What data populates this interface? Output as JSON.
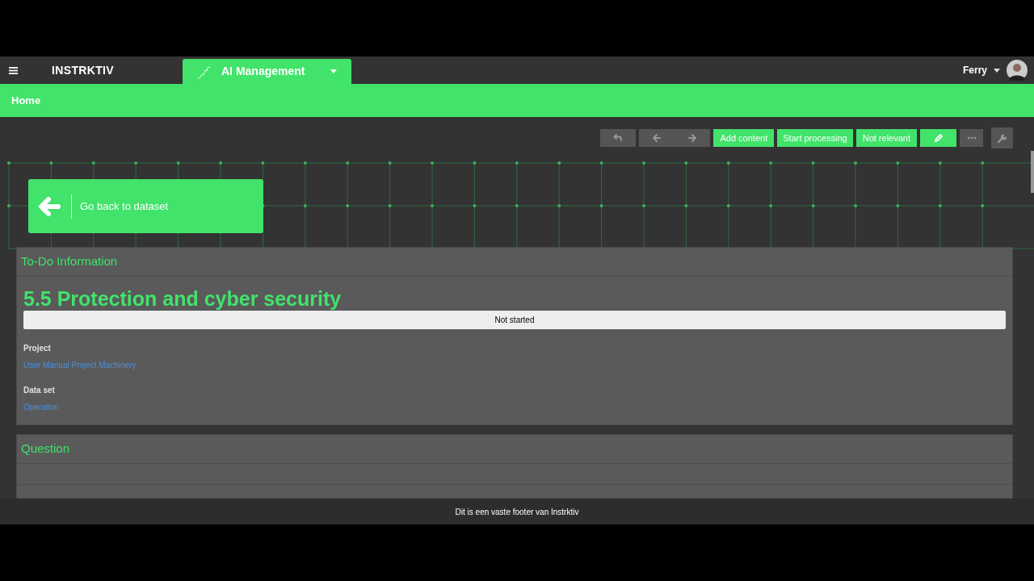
{
  "header": {
    "logo": "INSTRKTIV",
    "module": {
      "label": "AI Management",
      "selected": true
    },
    "user": "Ferry"
  },
  "breadcrumb": "Home",
  "toolbar": [
    {
      "kind": "icon",
      "disabled": true
    },
    {
      "kind": "icon",
      "disabled": true
    },
    {
      "kind": "icon",
      "disabled": true
    },
    {
      "kind": "text",
      "label": "Add content",
      "disabled": false
    },
    {
      "kind": "text",
      "label": "Start processing",
      "disabled": false
    },
    {
      "kind": "text",
      "label": "Not relevant",
      "disabled": false
    },
    {
      "kind": "icon",
      "disabled": false
    },
    {
      "kind": "icon",
      "disabled": true
    },
    {
      "kind": "icon",
      "disabled": true
    }
  ],
  "back_button": "Go back to dataset",
  "todo_panel": {
    "title": "To-Do Information",
    "heading": "5.5 Protection and cyber security",
    "status": "Not started",
    "fields": [
      {
        "label": "Project",
        "value": "User Manual Project Machinery"
      },
      {
        "label": "Data set",
        "value": "Operation"
      }
    ]
  },
  "question_panel": {
    "title": "Question"
  },
  "footer": "Dit is een vaste footer van Instrktiv"
}
